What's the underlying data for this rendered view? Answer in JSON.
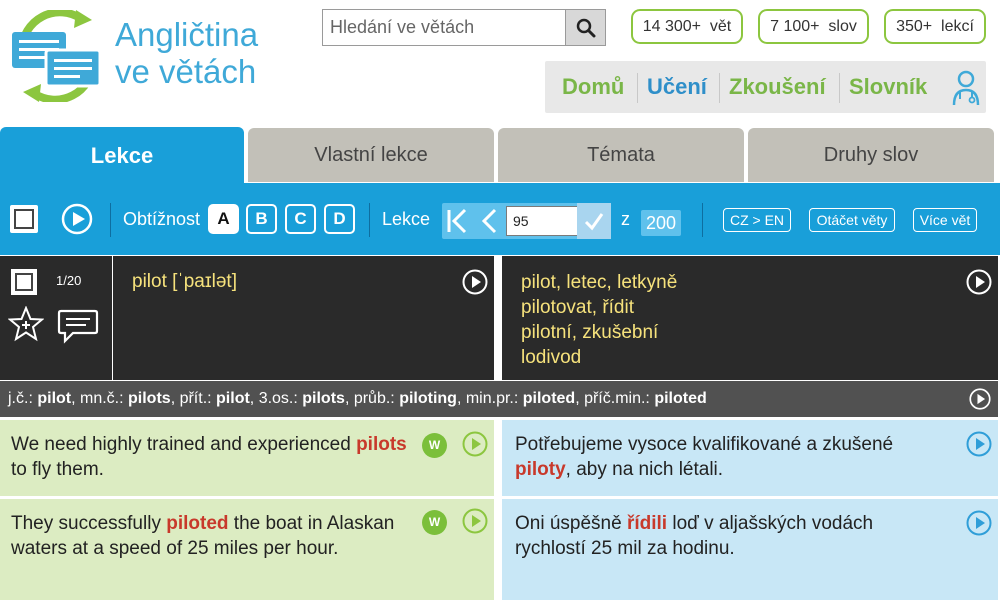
{
  "brand": {
    "line1": "Angličtina",
    "line2": "ve větách",
    "colors": {
      "blue": "#3fa9d8",
      "green": "#8cc63f"
    }
  },
  "search": {
    "placeholder": "Hledání ve větách",
    "icon": "search-icon"
  },
  "stats": [
    "14 300+  vět",
    "7 100+  slov",
    "350+  lekcí"
  ],
  "nav": {
    "items": [
      {
        "label": "Domů",
        "color": "#7ab648"
      },
      {
        "label": "Učení",
        "color": "#2f8fc9"
      },
      {
        "label": "Zkoušení",
        "color": "#7ab648"
      },
      {
        "label": "Slovník",
        "color": "#7ab648"
      }
    ],
    "user_icon": "user-doctor-icon"
  },
  "tabs": [
    "Lekce",
    "Vlastní lekce",
    "Témata",
    "Druhy slov"
  ],
  "toolbar": {
    "difficulty_label": "Obtížnost",
    "difficulty_levels": [
      "A",
      "B",
      "C",
      "D"
    ],
    "selected_level": "A",
    "lesson_label": "Lekce",
    "lesson_value": "95",
    "of_label": "z",
    "lesson_total": "200",
    "direction_btn": "CZ > EN",
    "rotate_btn": "Otáčet věty",
    "more_btn": "Více vět",
    "accent": "#199fd9"
  },
  "word": {
    "counter": "1/20",
    "headword": "pilot [ˈpaɪlət]",
    "translations": [
      "pilot, letec, letkyně",
      "pilotovat, řídit",
      "pilotní, zkušební",
      "lodivod"
    ]
  },
  "forms": [
    {
      "label": "j.č.: ",
      "value": "pilot",
      "sep": ", "
    },
    {
      "label": "mn.č.: ",
      "value": "pilots",
      "sep": ", "
    },
    {
      "label": "přít.: ",
      "value": "pilot",
      "sep": ", "
    },
    {
      "label": "3.os.: ",
      "value": "pilots",
      "sep": ", "
    },
    {
      "label": "průb.: ",
      "value": "piloting",
      "sep": ", "
    },
    {
      "label": "min.pr.: ",
      "value": "piloted",
      "sep": ", "
    },
    {
      "label": "příč.min.: ",
      "value": "piloted",
      "sep": ""
    }
  ],
  "sentences": [
    {
      "en": {
        "before": "We need highly trained and experienced ",
        "highlight": "pilots",
        "after": " to fly them."
      },
      "cz": {
        "before": "Potřebujeme vysoce kvalifikované a zkušené ",
        "highlight": "piloty",
        "after": ", aby na nich létali."
      },
      "badge": "W"
    },
    {
      "en": {
        "before": "They successfully ",
        "highlight": "piloted",
        "after": " the boat in Alaskan waters at a speed of 25 miles per hour."
      },
      "cz": {
        "before": "Oni úspěšně ",
        "highlight": "řídili",
        "after": " loď v aljašských vodách rychlostí 25 mil za hodinu."
      },
      "badge": "W"
    }
  ]
}
